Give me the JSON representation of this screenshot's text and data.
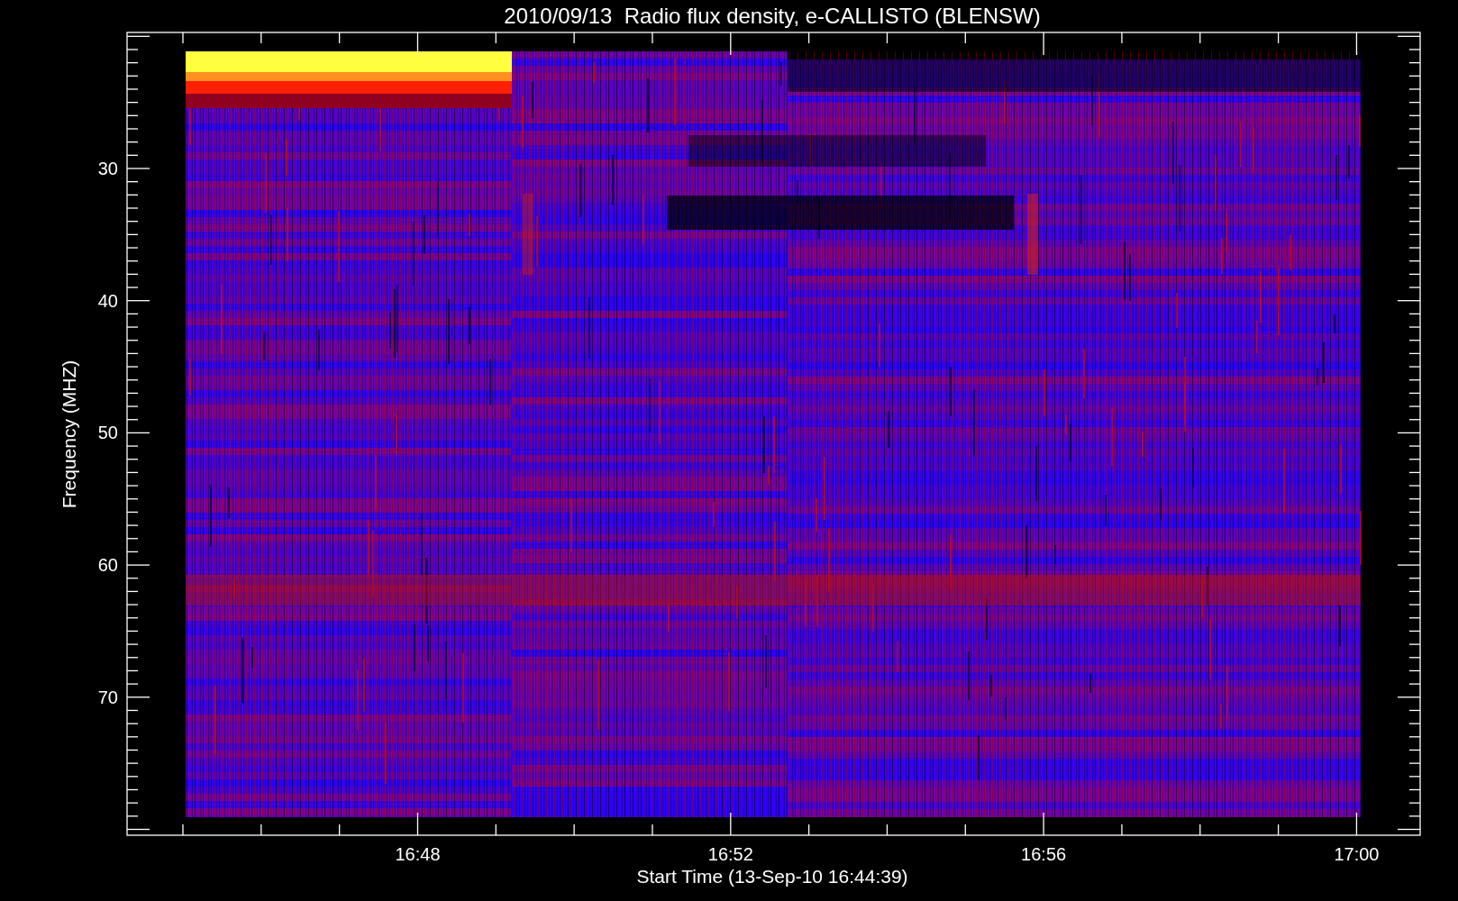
{
  "title": "2010/09/13  Radio flux density, e-CALLISTO (BLENSW)",
  "y_axis": {
    "label": "Frequency (MHZ)",
    "ticks": [
      "30",
      "40",
      "50",
      "60",
      "70"
    ]
  },
  "x_axis": {
    "label": "Start Time (13-Sep-10 16:44:39)",
    "ticks": [
      "16:48",
      "16:52",
      "16:56",
      "17:00"
    ]
  }
}
